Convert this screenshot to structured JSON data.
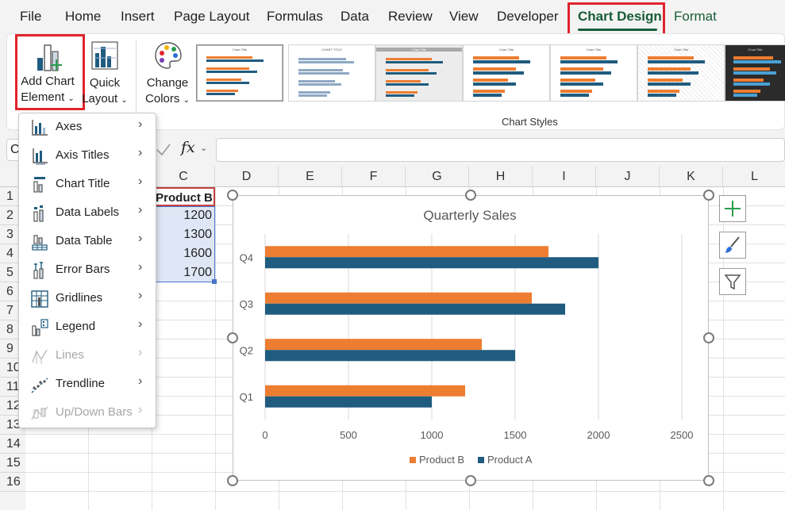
{
  "menu": {
    "tabs": [
      "File",
      "Home",
      "Insert",
      "Page Layout",
      "Formulas",
      "Data",
      "Review",
      "View",
      "Developer",
      "Chart Design",
      "Format"
    ],
    "active_tab": "Chart Design"
  },
  "ribbon": {
    "add_chart_element": {
      "line1": "Add Chart",
      "line2": "Element"
    },
    "quick_layout": {
      "line1": "Quick",
      "line2": "Layout"
    },
    "change_colors": {
      "line1": "Change",
      "line2": "Colors"
    },
    "chart_styles_label": "Chart Styles",
    "style_thumbnails": [
      {
        "title": "Chart Title",
        "dark": false
      },
      {
        "title": "CHART TITLE",
        "dark": false
      },
      {
        "title": "Chart Title",
        "dark": false
      },
      {
        "title": "Chart Title",
        "dark": false
      },
      {
        "title": "Chart Title",
        "dark": false
      },
      {
        "title": "Chart Title",
        "dark": false
      },
      {
        "title": "Chart Title",
        "dark": true
      }
    ]
  },
  "formula_bar": {
    "name_box": "C",
    "fx": "fx"
  },
  "columns": [
    "C",
    "D",
    "E",
    "F",
    "G",
    "H",
    "I",
    "J",
    "K",
    "L"
  ],
  "rows": [
    "1",
    "2",
    "3",
    "4",
    "5",
    "6",
    "7",
    "8",
    "9",
    "10",
    "11",
    "12",
    "13",
    "14",
    "15",
    "16"
  ],
  "sheet": {
    "header": "Product B",
    "values": [
      "1200",
      "1300",
      "1600",
      "1700"
    ]
  },
  "dropdown": {
    "items": [
      {
        "label": "Axes",
        "icon": "axes-icon",
        "enabled": true
      },
      {
        "label": "Axis Titles",
        "icon": "axis-titles-icon",
        "enabled": true
      },
      {
        "label": "Chart Title",
        "icon": "chart-title-icon",
        "enabled": true
      },
      {
        "label": "Data Labels",
        "icon": "data-labels-icon",
        "enabled": true
      },
      {
        "label": "Data Table",
        "icon": "data-table-icon",
        "enabled": true
      },
      {
        "label": "Error Bars",
        "icon": "error-bars-icon",
        "enabled": true
      },
      {
        "label": "Gridlines",
        "icon": "gridlines-icon",
        "enabled": true
      },
      {
        "label": "Legend",
        "icon": "legend-icon",
        "enabled": true
      },
      {
        "label": "Lines",
        "icon": "lines-icon",
        "enabled": false
      },
      {
        "label": "Trendline",
        "icon": "trendline-icon",
        "enabled": true
      },
      {
        "label": "Up/Down Bars",
        "icon": "up-down-bars-icon",
        "enabled": false
      }
    ]
  },
  "colors": {
    "accent": "#185c37",
    "highlight": "#e0242c",
    "product_a": "#1f5c7f",
    "product_b": "#ed7d31"
  },
  "chart_data": {
    "type": "bar",
    "orientation": "horizontal",
    "title": "Quarterly Sales",
    "categories": [
      "Q1",
      "Q2",
      "Q3",
      "Q4"
    ],
    "series": [
      {
        "name": "Product B",
        "values": [
          1200,
          1300,
          1600,
          1700
        ],
        "color": "#ed7d31"
      },
      {
        "name": "Product A",
        "values": [
          1000,
          1500,
          1800,
          2000
        ],
        "color": "#1f5c7f"
      }
    ],
    "xlim": [
      0,
      2500
    ],
    "xticks": [
      0,
      500,
      1000,
      1500,
      2000,
      2500
    ],
    "grid": true,
    "legend": "bottom"
  }
}
